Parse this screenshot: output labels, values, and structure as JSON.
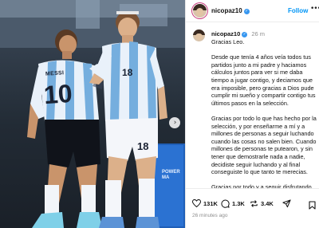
{
  "photo": {
    "jersey_name": "MESSI",
    "jersey_number_back": "10",
    "jersey_number_front": "18",
    "shorts_number": "18",
    "board_text": "POWER\nMA",
    "next_icon": "chevron-right-icon"
  },
  "post": {
    "username": "nicopaz10",
    "follow_label": "Follow",
    "comment_time": "26 m",
    "greeting": "Gracias Leo.",
    "paragraphs": [
      "Desde que tenía 4 años veía todos tus partidos junto a mi padre y haciamos cálculos juntos para ver si me daba tiempo a jugar contigo, y deciamos que era imposible, pero gracias a Dios pude cumplir mi sueño y compartir contigo tus últimos pasos en la selección.",
      "Gracias por todo lo que has hecho por la selección, y por enseñarme a mí y a millones de personas a seguir luchando cuando las cosas no salen bien. Cuando millones de personas te putearon, y sin tener que demostrarle nada a nadie, decidiste seguir luchando y al final conseguiste lo que tanto te merecias.",
      "Gracias por todo y a seguir disfrutando de lo que más te gusta, el fútbol, que"
    ],
    "likes": "131K",
    "comments": "1.3K",
    "reposts": "3.4K",
    "posted_time": "26 minutes ago",
    "accent_color": "#0095f6"
  }
}
